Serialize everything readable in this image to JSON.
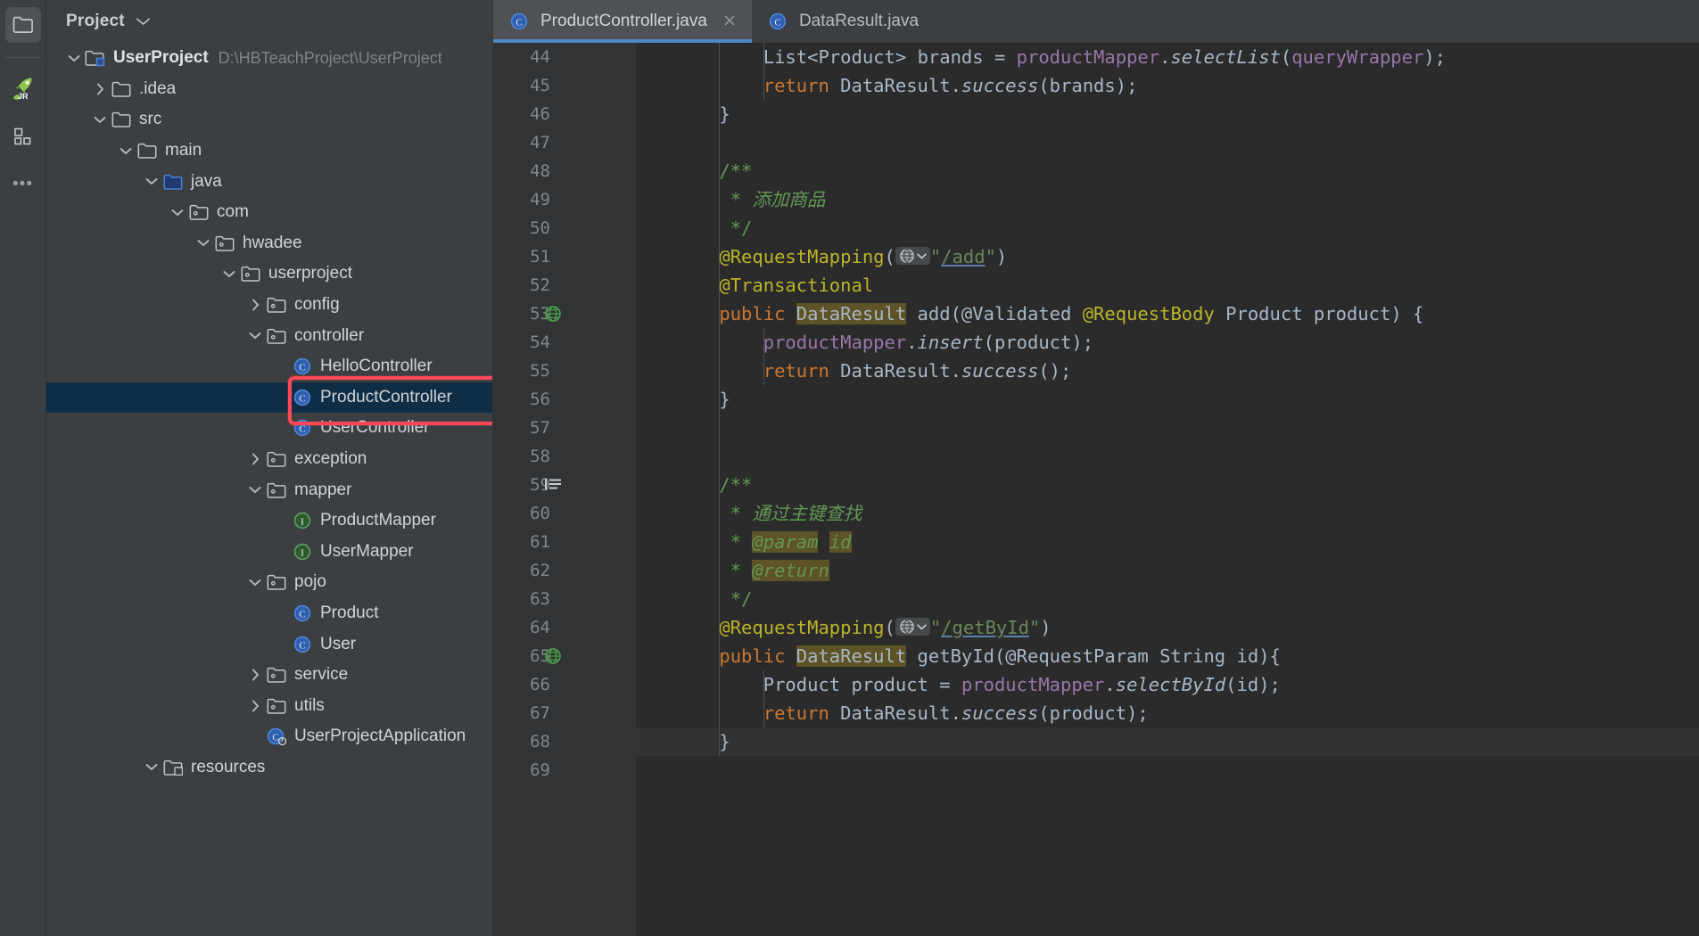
{
  "window": {
    "theme_bg": "#3c3f41",
    "editor_bg": "#2b2b2b",
    "accent": "#4a88c7",
    "highlight_box_color": "#ff4757",
    "selection_color": "#0f2e45"
  },
  "toolstrip": {
    "items": [
      {
        "name": "project-tool-window-icon",
        "glyph": "folder",
        "active": true
      },
      {
        "name": "jrebel-icon",
        "glyph": "rocket",
        "active": false
      },
      {
        "name": "structure-icon",
        "glyph": "blocks",
        "active": false
      },
      {
        "name": "more-tool-windows-icon",
        "glyph": "dots",
        "active": false
      }
    ]
  },
  "project_panel": {
    "title": "Project",
    "chevron": "˅",
    "tree": [
      {
        "label": "UserProject",
        "path": "D:\\HBTeachProject\\UserProject",
        "depth": 0,
        "arrow": "down",
        "icon": "module-folder",
        "bold": true
      },
      {
        "label": ".idea",
        "path": "",
        "depth": 1,
        "arrow": "right",
        "icon": "folder",
        "bold": false
      },
      {
        "label": "src",
        "path": "",
        "depth": 1,
        "arrow": "down",
        "icon": "folder",
        "bold": false
      },
      {
        "label": "main",
        "path": "",
        "depth": 2,
        "arrow": "down",
        "icon": "folder",
        "bold": false
      },
      {
        "label": "java",
        "path": "",
        "depth": 3,
        "arrow": "down",
        "icon": "source-folder",
        "bold": false
      },
      {
        "label": "com",
        "path": "",
        "depth": 4,
        "arrow": "down",
        "icon": "package",
        "bold": false
      },
      {
        "label": "hwadee",
        "path": "",
        "depth": 5,
        "arrow": "down",
        "icon": "package",
        "bold": false
      },
      {
        "label": "userproject",
        "path": "",
        "depth": 6,
        "arrow": "down",
        "icon": "package",
        "bold": false
      },
      {
        "label": "config",
        "path": "",
        "depth": 7,
        "arrow": "right",
        "icon": "package",
        "bold": false
      },
      {
        "label": "controller",
        "path": "",
        "depth": 7,
        "arrow": "down",
        "icon": "package",
        "bold": false
      },
      {
        "label": "HelloController",
        "path": "",
        "depth": 8,
        "arrow": "none",
        "icon": "java-class",
        "bold": false
      },
      {
        "label": "ProductController",
        "path": "",
        "depth": 8,
        "arrow": "none",
        "icon": "java-class",
        "bold": false,
        "selected": true,
        "highlighted": true
      },
      {
        "label": "UserController",
        "path": "",
        "depth": 8,
        "arrow": "none",
        "icon": "java-class",
        "bold": false
      },
      {
        "label": "exception",
        "path": "",
        "depth": 7,
        "arrow": "right",
        "icon": "package",
        "bold": false
      },
      {
        "label": "mapper",
        "path": "",
        "depth": 7,
        "arrow": "down",
        "icon": "package",
        "bold": false
      },
      {
        "label": "ProductMapper",
        "path": "",
        "depth": 8,
        "arrow": "none",
        "icon": "java-interface",
        "bold": false
      },
      {
        "label": "UserMapper",
        "path": "",
        "depth": 8,
        "arrow": "none",
        "icon": "java-interface",
        "bold": false
      },
      {
        "label": "pojo",
        "path": "",
        "depth": 7,
        "arrow": "down",
        "icon": "package",
        "bold": false
      },
      {
        "label": "Product",
        "path": "",
        "depth": 8,
        "arrow": "none",
        "icon": "java-class",
        "bold": false
      },
      {
        "label": "User",
        "path": "",
        "depth": 8,
        "arrow": "none",
        "icon": "java-class",
        "bold": false
      },
      {
        "label": "service",
        "path": "",
        "depth": 7,
        "arrow": "right",
        "icon": "package",
        "bold": false
      },
      {
        "label": "utils",
        "path": "",
        "depth": 7,
        "arrow": "right",
        "icon": "package",
        "bold": false
      },
      {
        "label": "UserProjectApplication",
        "path": "",
        "depth": 7,
        "arrow": "none",
        "icon": "spring-class",
        "bold": false
      },
      {
        "label": "resources",
        "path": "",
        "depth": 3,
        "arrow": "down",
        "icon": "resource-folder",
        "bold": false
      }
    ]
  },
  "editor": {
    "tabs": [
      {
        "label": "ProductController.java",
        "icon": "java-class",
        "active": true,
        "closable": true
      },
      {
        "label": "DataResult.java",
        "icon": "java-class",
        "active": false,
        "closable": false
      }
    ],
    "first_line_number": 44,
    "last_line_number": 69,
    "lines": [
      {
        "n": 44,
        "text": "        List<Product> brands = productMapper.selectList(queryWrapper);"
      },
      {
        "n": 45,
        "text": "        return DataResult.success(brands);"
      },
      {
        "n": 46,
        "text": "    }"
      },
      {
        "n": 47,
        "text": ""
      },
      {
        "n": 48,
        "text": "    /**"
      },
      {
        "n": 49,
        "text": "     * 添加商品"
      },
      {
        "n": 50,
        "text": "     */"
      },
      {
        "n": 51,
        "text": "    @RequestMapping(\"/add\")"
      },
      {
        "n": 52,
        "text": "    @Transactional"
      },
      {
        "n": 53,
        "text": "    public DataResult add(@Validated @RequestBody Product product) {",
        "gutter_icon": "spring-web-bean"
      },
      {
        "n": 54,
        "text": "        productMapper.insert(product);"
      },
      {
        "n": 55,
        "text": "        return DataResult.success();"
      },
      {
        "n": 56,
        "text": "    }"
      },
      {
        "n": 57,
        "text": ""
      },
      {
        "n": 58,
        "text": ""
      },
      {
        "n": 59,
        "text": "    /**",
        "gutter_icon": "javadoc-format"
      },
      {
        "n": 60,
        "text": "     * 通过主键查找"
      },
      {
        "n": 61,
        "text": "     * @param id"
      },
      {
        "n": 62,
        "text": "     * @return"
      },
      {
        "n": 63,
        "text": "     */"
      },
      {
        "n": 64,
        "text": "    @RequestMapping(\"/getById\")"
      },
      {
        "n": 65,
        "text": "    public DataResult getById(@RequestParam String id){",
        "gutter_icon": "spring-web-bean"
      },
      {
        "n": 66,
        "text": "        Product product = productMapper.selectById(id);"
      },
      {
        "n": 67,
        "text": "        return DataResult.success(product);"
      },
      {
        "n": 68,
        "text": "    }",
        "current": true
      },
      {
        "n": 69,
        "text": ""
      }
    ],
    "annotations": {
      "request_mapping_add_value": "/add",
      "request_mapping_getbyid_value": "/getById",
      "transactional": "@Transactional",
      "highlighted_symbol": "DataResult",
      "javadoc_tags": [
        "@param",
        "@return"
      ]
    },
    "comments_cn": {
      "add_method": "添加商品",
      "getbyid_method": "通过主键查找"
    }
  }
}
